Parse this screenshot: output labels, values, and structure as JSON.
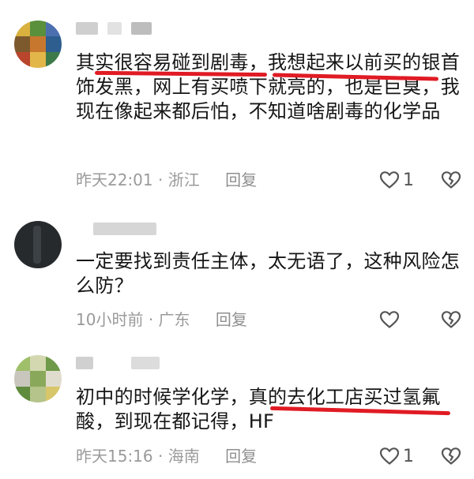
{
  "comments": [
    {
      "text": "其实很容易碰到剧毒，我想起来以前买的银首饰发黑，网上有买喷下就亮的，也是巨臭，我现在像起来都后怕，不知道啥剧毒的化学品",
      "time": "昨天22:01",
      "location": "浙江",
      "reply_label": "回复",
      "like_count": "1"
    },
    {
      "text": "一定要找到责任主体，太无语了，这种风险怎么防？",
      "time": "10小时前",
      "location": "广东",
      "reply_label": "回复",
      "like_count": ""
    },
    {
      "text": "初中的时候学化学，真的去化工店买过氢氟酸，到现在都记得，HF",
      "time": "昨天15:16",
      "location": "海南",
      "reply_label": "回复",
      "like_count": "1"
    }
  ],
  "separator": "·",
  "icons": {
    "like": "heart-outline-icon",
    "dislike": "broken-heart-icon"
  },
  "colors": {
    "highlight": "#e01b24",
    "meta": "#9a9a9a"
  }
}
